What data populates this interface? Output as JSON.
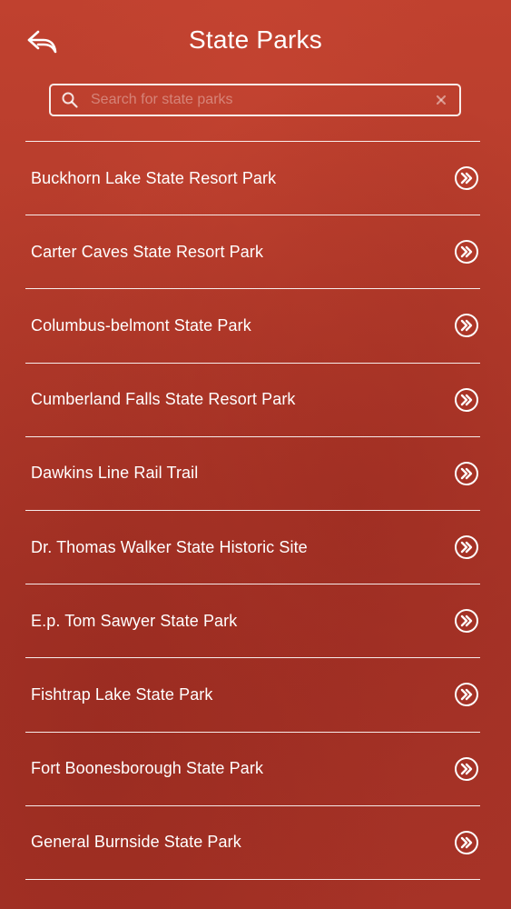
{
  "header": {
    "title": "State Parks",
    "back_icon": "back-arrow-icon"
  },
  "search": {
    "placeholder": "Search for state parks",
    "value": "",
    "icon": "search-icon",
    "clear_icon": "close-icon"
  },
  "parks": [
    {
      "label": "Buckhorn Lake State Resort Park",
      "icon": "double-chevron-right-icon"
    },
    {
      "label": "Carter Caves State Resort Park",
      "icon": "double-chevron-right-icon"
    },
    {
      "label": "Columbus-belmont State Park",
      "icon": "double-chevron-right-icon"
    },
    {
      "label": "Cumberland Falls State Resort Park",
      "icon": "double-chevron-right-icon"
    },
    {
      "label": "Dawkins Line Rail Trail",
      "icon": "double-chevron-right-icon"
    },
    {
      "label": "Dr. Thomas Walker State Historic Site",
      "icon": "double-chevron-right-icon"
    },
    {
      "label": "E.p. Tom Sawyer State Park",
      "icon": "double-chevron-right-icon"
    },
    {
      "label": "Fishtrap Lake State Park",
      "icon": "double-chevron-right-icon"
    },
    {
      "label": "Fort Boonesborough State Park",
      "icon": "double-chevron-right-icon"
    },
    {
      "label": "General Burnside State Park",
      "icon": "double-chevron-right-icon"
    }
  ],
  "colors": {
    "background": "#b23d2a",
    "foreground": "#ffffff"
  }
}
